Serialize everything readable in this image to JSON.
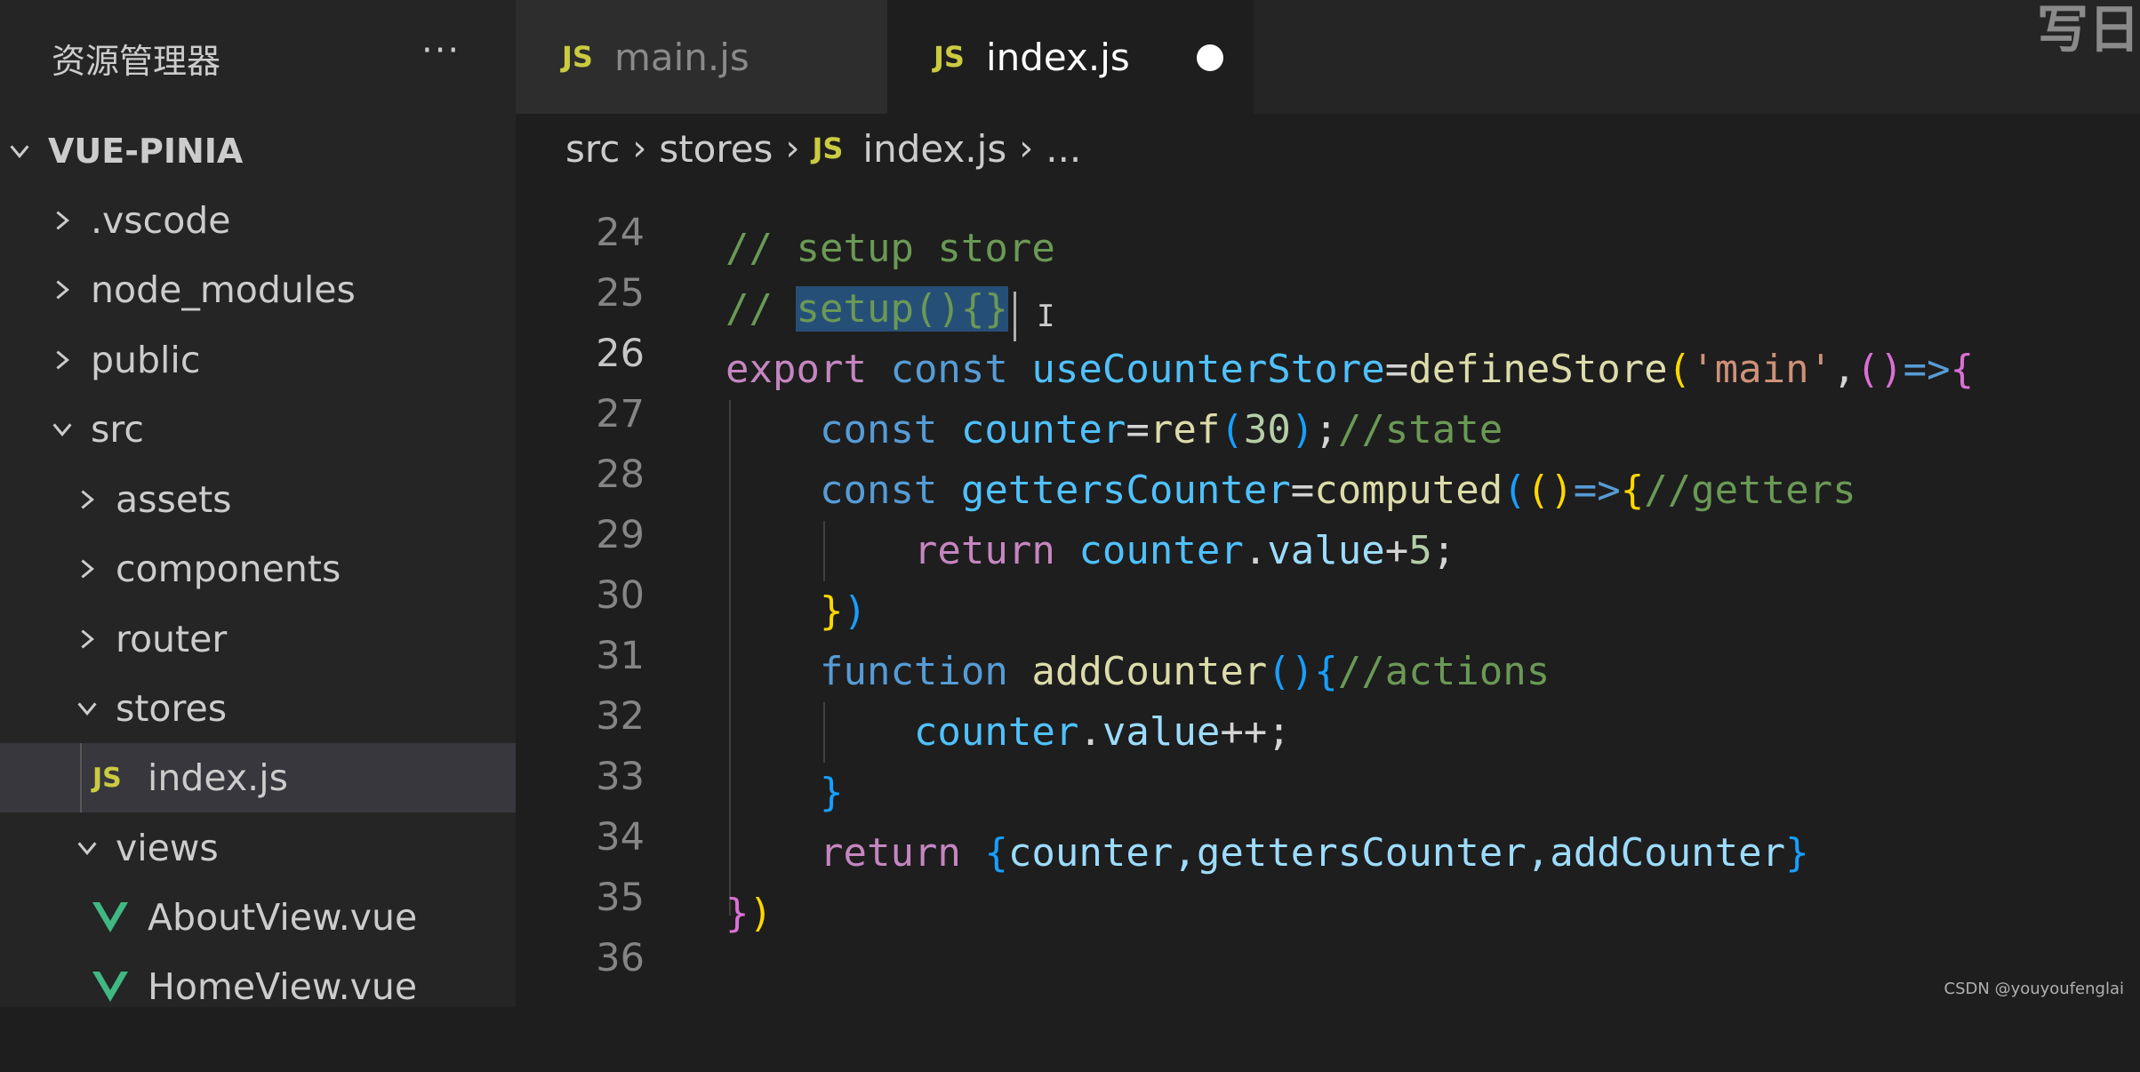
{
  "explorer": {
    "title": "资源管理器",
    "more": "···",
    "root": "VUE-PINIA",
    "items": [
      {
        "label": ".vscode",
        "type": "folder",
        "expanded": false
      },
      {
        "label": "node_modules",
        "type": "folder",
        "expanded": false
      },
      {
        "label": "public",
        "type": "folder",
        "expanded": false
      },
      {
        "label": "src",
        "type": "folder",
        "expanded": true
      },
      {
        "label": "assets",
        "type": "folder",
        "expanded": false
      },
      {
        "label": "components",
        "type": "folder",
        "expanded": false
      },
      {
        "label": "router",
        "type": "folder",
        "expanded": false
      },
      {
        "label": "stores",
        "type": "folder",
        "expanded": true
      },
      {
        "label": "index.js",
        "type": "js",
        "selected": true
      },
      {
        "label": "views",
        "type": "folder",
        "expanded": true
      },
      {
        "label": "AboutView.vue",
        "type": "vue"
      },
      {
        "label": "HomeView.vue",
        "type": "vue"
      }
    ],
    "js_badge": "JS"
  },
  "tabs": [
    {
      "label": "main.js",
      "icon": "JS",
      "active": false
    },
    {
      "label": "index.js",
      "icon": "JS",
      "active": true,
      "modified": true
    }
  ],
  "corner_text": "写日",
  "breadcrumb": {
    "parts": [
      "src",
      "stores"
    ],
    "file_icon": "JS",
    "file": "index.js",
    "tail": "..."
  },
  "code": {
    "line_numbers": [
      "24",
      "25",
      "26",
      "27",
      "28",
      "29",
      "30",
      "31",
      "32",
      "33",
      "34",
      "35",
      "36"
    ],
    "current_line": "26",
    "line_25": {
      "comment": "// setup store"
    },
    "line_26": {
      "prefix": "// ",
      "selected": "setup(){}"
    },
    "line_27": {
      "kw": "export",
      "decl": "const",
      "name": "useCounterStore",
      "eq": "=",
      "fn": "defineStore",
      "p1": "(",
      "str": "'main'",
      "comma": ",",
      "p2": "()",
      "arrow": "=>",
      "brace": "{"
    },
    "line_28": {
      "decl": "const",
      "name": "counter",
      "eq": "=",
      "fn": "ref",
      "p1": "(",
      "num": "30",
      "p2": ")",
      "semi": ";",
      "comment": "//state"
    },
    "line_29": {
      "decl": "const",
      "name": "gettersCounter",
      "eq": "=",
      "fn": "computed",
      "p1": "(",
      "p2": "()",
      "arrow": "=>",
      "brace": "{",
      "comment": "//getters"
    },
    "line_30": {
      "kw": "return",
      "obj": "counter",
      "dot": ".",
      "prop": "value",
      "rest": "+",
      "num": "5",
      "semi": ";"
    },
    "line_31": {
      "b1": "}",
      "b2": ")"
    },
    "line_32": {
      "decl": "function",
      "fn": "addCounter",
      "p": "()",
      "brace": "{",
      "comment": "//actions"
    },
    "line_33": {
      "obj": "counter",
      "dot": ".",
      "prop": "value",
      "rest": "++;"
    },
    "line_34": {
      "b": "}"
    },
    "line_35": {
      "kw": "return",
      "b1": "{",
      "body": "counter,gettersCounter,addCounter",
      "b2": "}"
    },
    "line_36": {
      "b1": "}",
      "b2": ")"
    }
  },
  "watermark": "CSDN @youyoufenglai",
  "colors": {
    "js_yellow": "#cbcb41",
    "vue_green": "#41b883",
    "selection": "#264f78",
    "comment": "#6a9955"
  }
}
